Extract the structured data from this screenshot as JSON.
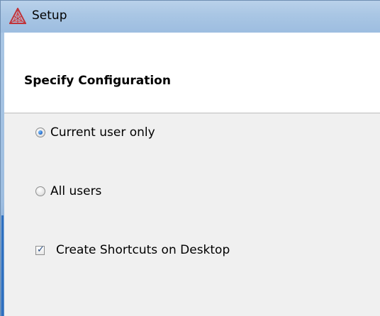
{
  "window": {
    "title": "Setup",
    "icon": "setup-app-icon"
  },
  "header": {
    "title": "Specify Configuration"
  },
  "options": {
    "current_user": {
      "label": "Current user only",
      "selected": true
    },
    "all_users": {
      "label": "All users",
      "selected": false
    },
    "shortcuts": {
      "label": "Create Shortcuts on Desktop",
      "checked": true
    }
  },
  "colors": {
    "titlebar": "#a9c6e4",
    "body_bg": "#f0f0f0",
    "accent": "#1e63c4",
    "icon_red": "#c0343a"
  }
}
